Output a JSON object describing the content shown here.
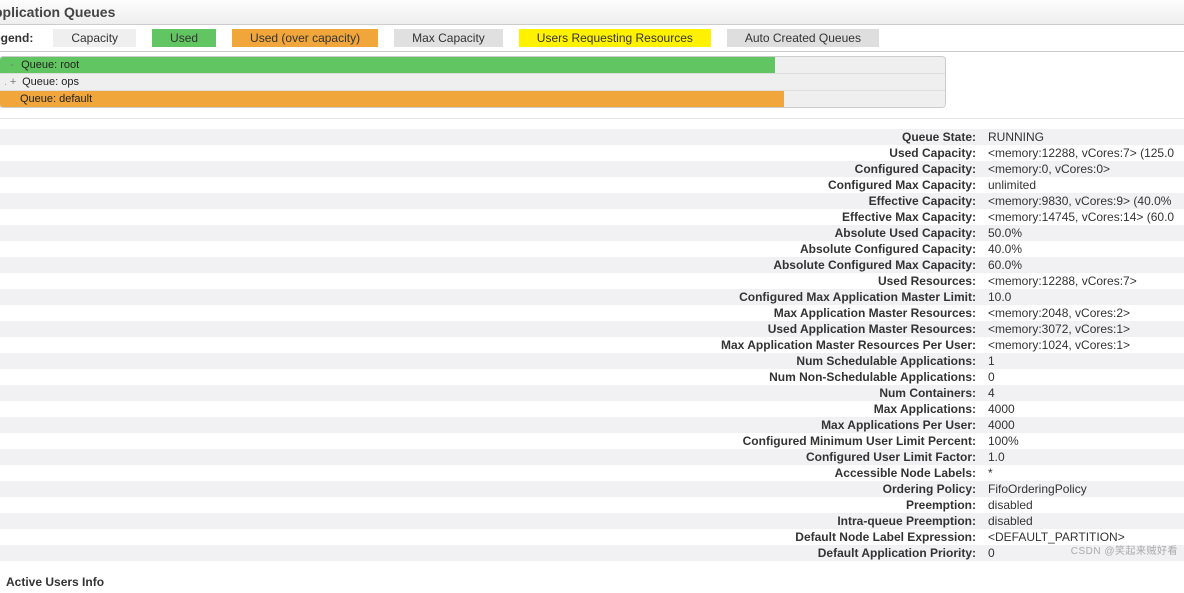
{
  "header": {
    "title": "pplication Queues",
    "legend_label": "egend:",
    "legend": {
      "capacity": "Capacity",
      "used": "Used",
      "over": "Used (over capacity)",
      "max": "Max Capacity",
      "users": "Users Requesting Resources",
      "auto": "Auto Created Queues"
    }
  },
  "queues": {
    "root": {
      "label": "Queue: root",
      "bar_class": "bar-green",
      "bar_pct": "82%"
    },
    "ops": {
      "label": "Queue: ops",
      "bar_class": "",
      "bar_pct": "0%"
    },
    "default": {
      "label": "Queue: default",
      "bar_class": "bar-orange",
      "bar_pct": "83%"
    }
  },
  "details": [
    {
      "k": "Queue State:",
      "v": "RUNNING"
    },
    {
      "k": "Used Capacity:",
      "v": "<memory:12288, vCores:7> (125.0"
    },
    {
      "k": "Configured Capacity:",
      "v": "<memory:0, vCores:0>"
    },
    {
      "k": "Configured Max Capacity:",
      "v": "unlimited"
    },
    {
      "k": "Effective Capacity:",
      "v": "<memory:9830, vCores:9> (40.0%"
    },
    {
      "k": "Effective Max Capacity:",
      "v": "<memory:14745, vCores:14> (60.0"
    },
    {
      "k": "Absolute Used Capacity:",
      "v": "50.0%"
    },
    {
      "k": "Absolute Configured Capacity:",
      "v": "40.0%"
    },
    {
      "k": "Absolute Configured Max Capacity:",
      "v": "60.0%"
    },
    {
      "k": "Used Resources:",
      "v": "<memory:12288, vCores:7>"
    },
    {
      "k": "Configured Max Application Master Limit:",
      "v": "10.0"
    },
    {
      "k": "Max Application Master Resources:",
      "v": "<memory:2048, vCores:2>"
    },
    {
      "k": "Used Application Master Resources:",
      "v": "<memory:3072, vCores:1>"
    },
    {
      "k": "Max Application Master Resources Per User:",
      "v": "<memory:1024, vCores:1>"
    },
    {
      "k": "Num Schedulable Applications:",
      "v": "1"
    },
    {
      "k": "Num Non-Schedulable Applications:",
      "v": "0"
    },
    {
      "k": "Num Containers:",
      "v": "4"
    },
    {
      "k": "Max Applications:",
      "v": "4000"
    },
    {
      "k": "Max Applications Per User:",
      "v": "4000"
    },
    {
      "k": "Configured Minimum User Limit Percent:",
      "v": "100%"
    },
    {
      "k": "Configured User Limit Factor:",
      "v": "1.0"
    },
    {
      "k": "Accessible Node Labels:",
      "v": "*"
    },
    {
      "k": "Ordering Policy:",
      "v": "FifoOrderingPolicy"
    },
    {
      "k": "Preemption:",
      "v": "disabled"
    },
    {
      "k": "Intra-queue Preemption:",
      "v": "disabled"
    },
    {
      "k": "Default Node Label Expression:",
      "v": "<DEFAULT_PARTITION>"
    },
    {
      "k": "Default Application Priority:",
      "v": "0"
    }
  ],
  "sections": {
    "active_users": "Active Users Info"
  },
  "watermark": "CSDN @笑起来贼好看"
}
